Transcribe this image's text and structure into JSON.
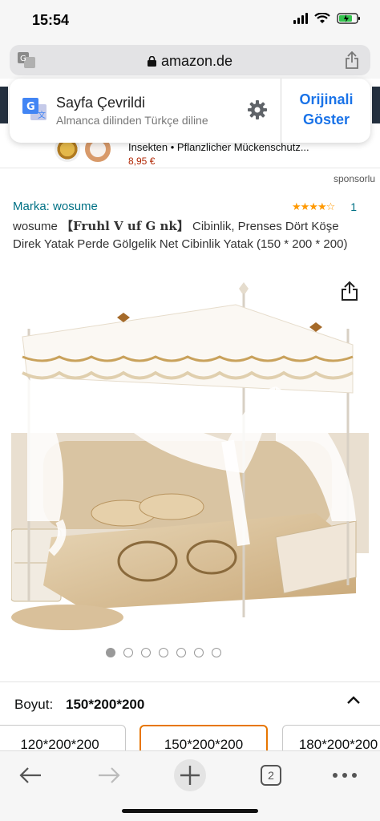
{
  "status_bar": {
    "time": "15:54"
  },
  "browser": {
    "url": "amazon.de"
  },
  "translation_banner": {
    "title": "Sayfa Çevrildi",
    "subtitle": "Almanca dilinden Türkçe diline",
    "original_button": "Orijinali Göster"
  },
  "ad": {
    "title": "Insekten • Pflanzlicher Mückenschutz...",
    "price": "8,95 €",
    "sponsored_label": "sponsorlu"
  },
  "product": {
    "brand_prefix": "Marka:",
    "brand": "wosume",
    "rating": 4.5,
    "rating_stars": "★★★★☆",
    "rating_count": "1",
    "title_brand": "wosume",
    "title_bracket": "【Fruhl V uf G nk】",
    "title_rest": "Cibinlik, Prenses Dört Köşe Direk Yatak Perde Gölgelik Net Cibinlik Yatak (150 * 200 * 200)"
  },
  "carousel": {
    "count": 7,
    "active_index": 0
  },
  "size": {
    "label": "Boyut:",
    "selected_value": "150*200*200",
    "options": [
      "120*200*200",
      "150*200*200",
      "180*200*200"
    ],
    "selected_index": 1
  },
  "toolbar": {
    "tab_count": "2"
  },
  "colors": {
    "link": "#007185",
    "star": "#ff9900",
    "price": "#b12704",
    "selected_border": "#e77600",
    "translate_blue": "#1a73e8"
  },
  "icons": [
    "translate-icon",
    "lock-icon",
    "share-icon",
    "gear-icon",
    "chevron-up-icon",
    "back-arrow-icon",
    "forward-arrow-icon",
    "plus-icon",
    "tabs-icon",
    "more-icon"
  ]
}
